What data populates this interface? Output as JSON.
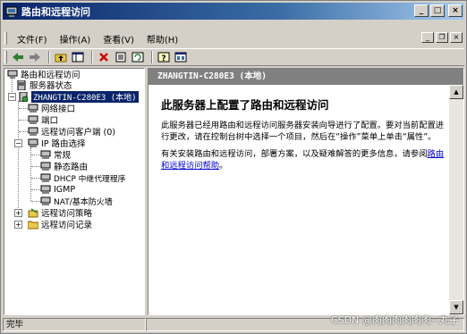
{
  "window": {
    "title": "路由和远程访问",
    "controls": {
      "minimize": "_",
      "maximize": "□",
      "close": "×"
    }
  },
  "menubar": {
    "items": [
      "文件(F)",
      "操作(A)",
      "查看(V)",
      "帮助(H)"
    ],
    "child_controls": {
      "minimize": "_",
      "restore": "❐",
      "close": "×"
    }
  },
  "toolbar": {
    "buttons": [
      "back-icon",
      "forward-icon",
      "up-folder-icon",
      "show-tree-icon",
      "delete-icon",
      "properties-icon",
      "refresh-icon",
      "help-icon",
      "console-icon"
    ]
  },
  "tree": {
    "items": [
      {
        "label": "路由和远程访问"
      },
      {
        "label": "服务器状态"
      },
      {
        "label": "ZHANGTIN-C280E3 (本地)"
      },
      {
        "label": "网络接口"
      },
      {
        "label": "端口"
      },
      {
        "label": "远程访问客户端 (0)"
      },
      {
        "label": "IP 路由选择"
      },
      {
        "label": "常规"
      },
      {
        "label": "静态路由"
      },
      {
        "label": "DHCP 中继代理程序"
      },
      {
        "label": "IGMP"
      },
      {
        "label": "NAT/基本防火墙"
      },
      {
        "label": "远程访问策略"
      },
      {
        "label": "远程访问记录"
      }
    ]
  },
  "right": {
    "header": "ZHANGTIN-C280E3 (本地)",
    "heading": "此服务器上配置了路由和远程访问",
    "para1": "此服务器已经用路由和远程访问服务器安装向导进行了配置。要对当前配置进行更改，请在控制台树中选择一个项目，然后在“操作”菜单上单击“属性”。",
    "para2_prefix": "有关安装路由和远程访问，部署方案，以及疑难解答的更多信息，请参阅",
    "para2_link": "路由和远程访问帮助",
    "para2_suffix": "。"
  },
  "status": {
    "text": "完毕"
  },
  "watermark": "CSDN @肉肉肉肉肉肉~丸子",
  "colors": {
    "title_start": "#0a246a",
    "title_end": "#a6caf0",
    "selection": "#0a246a",
    "link": "#0000cc",
    "header_bg": "#808080"
  }
}
